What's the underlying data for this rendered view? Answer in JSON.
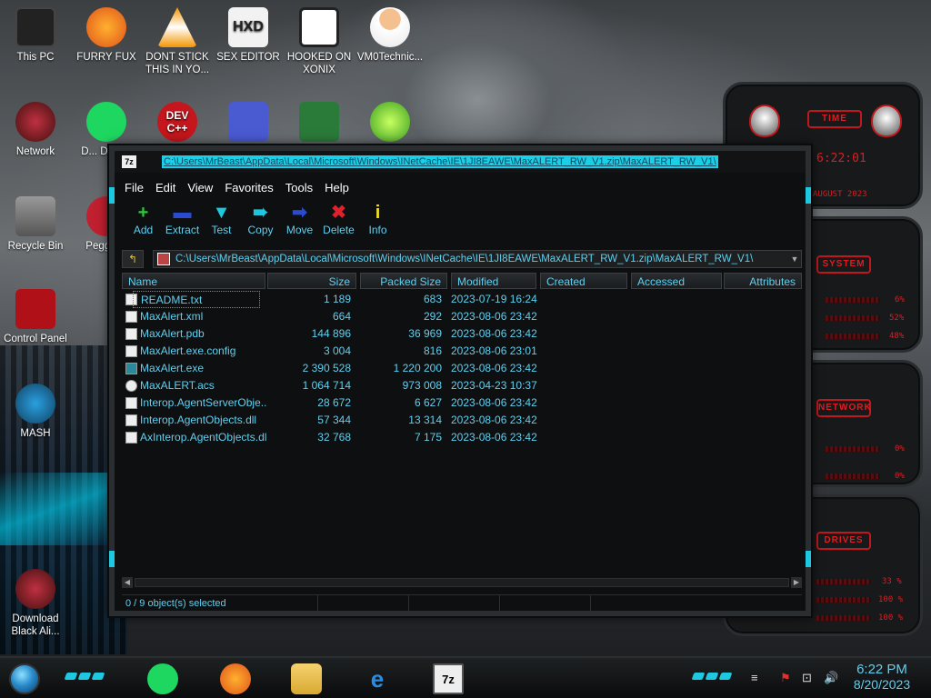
{
  "desktop": {
    "icons": [
      {
        "label": "This PC"
      },
      {
        "label": "FURRY FUX"
      },
      {
        "label": "DONT STICK THIS IN YO..."
      },
      {
        "label": "SEX EDITOR"
      },
      {
        "label": "HOOKED ON XONIX"
      },
      {
        "label": "VM0Technic..."
      },
      {
        "label": "Network"
      },
      {
        "label": "D... DUN..."
      },
      {
        "label": "Recycle Bin"
      },
      {
        "label": "Peggle..."
      },
      {
        "label": "Control Panel"
      },
      {
        "label": "MASH"
      },
      {
        "label": "Download Black Ali..."
      },
      {
        "label": ""
      },
      {
        "label": ""
      },
      {
        "label": ""
      },
      {
        "label": ""
      },
      {
        "label": ""
      }
    ],
    "dev_icon_text": "DEV C++",
    "hxd_icon_text": "HXD"
  },
  "widgets": {
    "time_title": "TIME",
    "time_value": "6:22:01",
    "date_value": "AUGUST 2023",
    "system_title": "SYSTEM",
    "system_values": [
      "6%",
      "52%",
      "48%"
    ],
    "network_title": "NETWORK",
    "network_values": [
      "0%",
      "0%"
    ],
    "drives_title": "DRIVES",
    "drive_values": [
      "33 %",
      "100 %",
      "100 %"
    ]
  },
  "window": {
    "app_icon": "7z",
    "title": "C:\\Users\\MrBeast\\AppData\\Local\\Microsoft\\Windows\\INetCache\\IE\\1JI8EAWE\\MaxALERT_RW_V1.zip\\MaxALERT_RW_V1\\",
    "menu": [
      "File",
      "Edit",
      "View",
      "Favorites",
      "Tools",
      "Help"
    ],
    "toolbar": [
      {
        "label": "Add",
        "icon": "plus-icon"
      },
      {
        "label": "Extract",
        "icon": "minus-icon"
      },
      {
        "label": "Test",
        "icon": "check-icon"
      },
      {
        "label": "Copy",
        "icon": "arrow-copy-icon"
      },
      {
        "label": "Move",
        "icon": "arrow-move-icon"
      },
      {
        "label": "Delete",
        "icon": "x-icon"
      },
      {
        "label": "Info",
        "icon": "info-icon"
      }
    ],
    "address": "C:\\Users\\MrBeast\\AppData\\Local\\Microsoft\\Windows\\INetCache\\IE\\1JI8EAWE\\MaxALERT_RW_V1.zip\\MaxALERT_RW_V1\\",
    "columns": [
      "Name",
      "Size",
      "Packed Size",
      "Modified",
      "Created",
      "Accessed",
      "Attributes"
    ],
    "files": [
      {
        "name": "README.txt",
        "size": "1 189",
        "packed": "683",
        "modified": "2023-07-19 16:24"
      },
      {
        "name": "MaxAlert.xml",
        "size": "664",
        "packed": "292",
        "modified": "2023-08-06 23:42"
      },
      {
        "name": "MaxAlert.pdb",
        "size": "144 896",
        "packed": "36 969",
        "modified": "2023-08-06 23:42"
      },
      {
        "name": "MaxAlert.exe.config",
        "size": "3 004",
        "packed": "816",
        "modified": "2023-08-06 23:01"
      },
      {
        "name": "MaxAlert.exe",
        "size": "2 390 528",
        "packed": "1 220 200",
        "modified": "2023-08-06 23:42"
      },
      {
        "name": "MaxALERT.acs",
        "size": "1 064 714",
        "packed": "973 008",
        "modified": "2023-04-23 10:37"
      },
      {
        "name": "Interop.AgentServerObje...",
        "size": "28 672",
        "packed": "6 627",
        "modified": "2023-08-06 23:42"
      },
      {
        "name": "Interop.AgentObjects.dll",
        "size": "57 344",
        "packed": "13 314",
        "modified": "2023-08-06 23:42"
      },
      {
        "name": "AxInterop.AgentObjects.dll",
        "size": "32 768",
        "packed": "7 175",
        "modified": "2023-08-06 23:42"
      }
    ],
    "status": "0 / 9 object(s) selected"
  },
  "taskbar": {
    "time": "6:22 PM",
    "date": "8/20/2023",
    "sevenzip_label": "7z"
  }
}
